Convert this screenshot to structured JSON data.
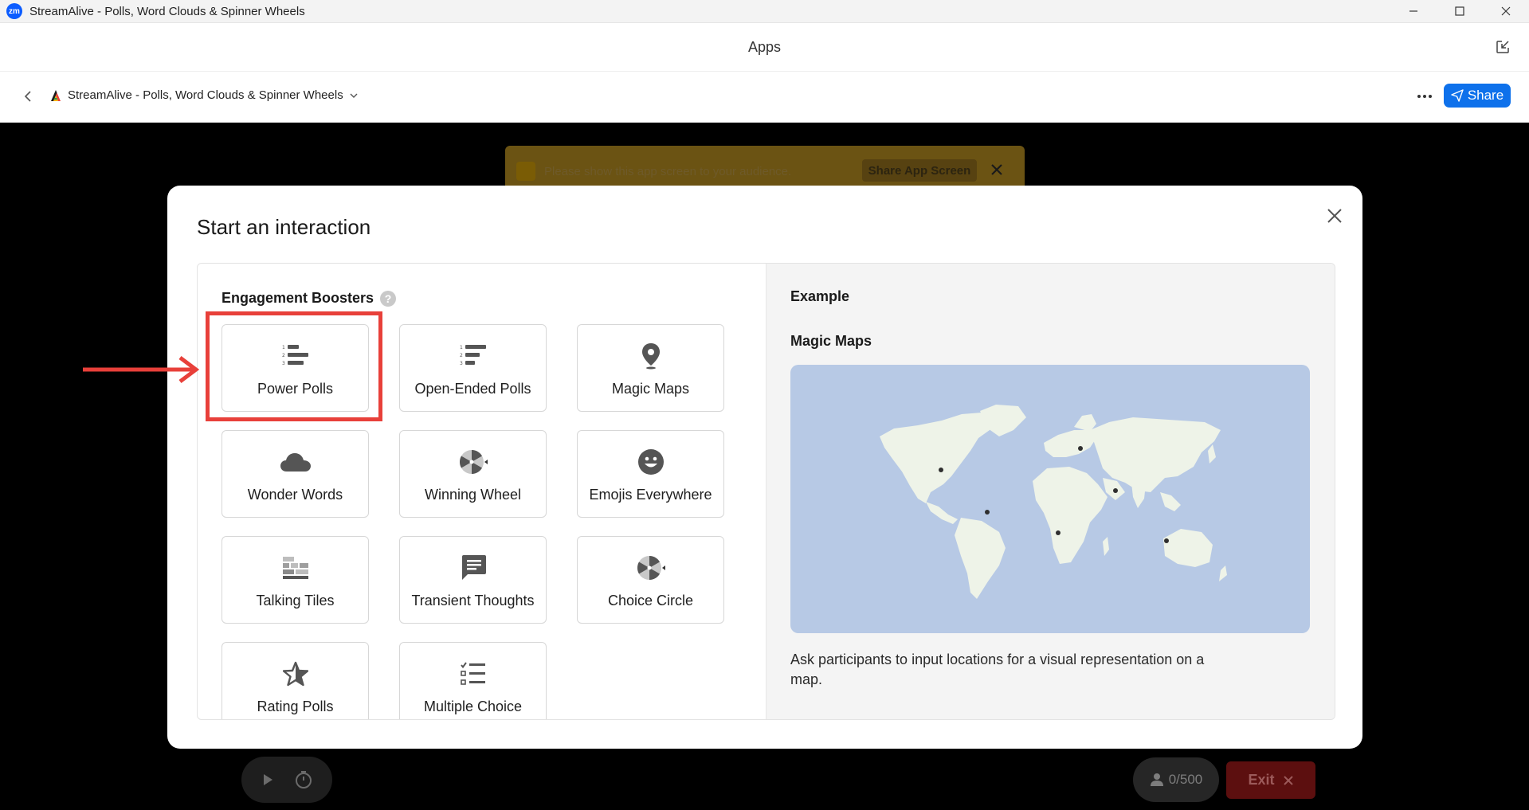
{
  "window": {
    "logo_text": "zm",
    "title": "StreamAlive - Polls, Word Clouds & Spinner Wheels"
  },
  "apps_header": {
    "title": "Apps"
  },
  "app_bar": {
    "app_name": "StreamAlive - Polls, Word Clouds & Spinner Wheels",
    "share_label": "Share"
  },
  "notice": {
    "message": "Please show this app screen to your audience.",
    "share_button": "Share App Screen"
  },
  "footer": {
    "participants": "0/500",
    "exit_label": "Exit"
  },
  "modal": {
    "title": "Start an interaction",
    "section_title": "Engagement Boosters",
    "help": "?",
    "cards": [
      {
        "label": "Power Polls",
        "icon": "ranked-list-icon"
      },
      {
        "label": "Open-Ended Polls",
        "icon": "ranked-list-icon"
      },
      {
        "label": "Magic Maps",
        "icon": "map-pin-icon"
      },
      {
        "label": "Wonder Words",
        "icon": "cloud-icon"
      },
      {
        "label": "Winning Wheel",
        "icon": "spinner-wheel-icon"
      },
      {
        "label": "Emojis Everywhere",
        "icon": "smiley-icon"
      },
      {
        "label": "Talking Tiles",
        "icon": "tiles-icon"
      },
      {
        "label": "Transient Thoughts",
        "icon": "chat-bubble-icon"
      },
      {
        "label": "Choice Circle",
        "icon": "spinner-wheel-icon"
      },
      {
        "label": "Rating Polls",
        "icon": "star-icon"
      },
      {
        "label": "Multiple Choice",
        "icon": "checklist-icon"
      }
    ],
    "example": {
      "label": "Example",
      "title": "Magic Maps",
      "description": "Ask participants to input locations for a visual representation on a map."
    }
  },
  "colors": {
    "accent_blue": "#0e71eb",
    "highlight_red": "#e8403a",
    "map_ocean": "#b7c9e5",
    "map_land": "#eef3e8"
  }
}
